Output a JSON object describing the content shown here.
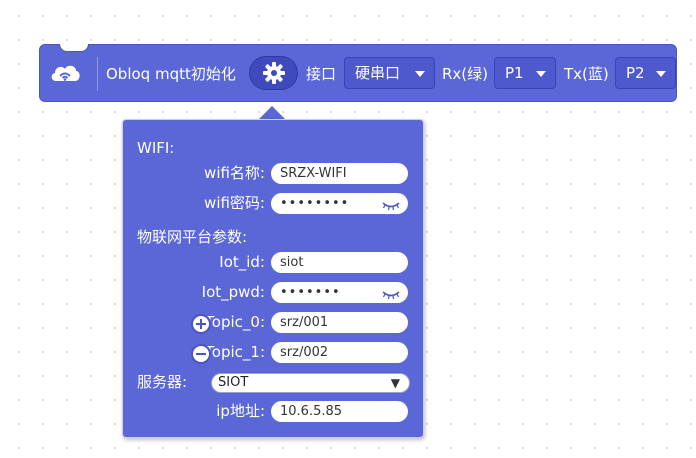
{
  "block": {
    "cloud_icon": "cloud-wifi-icon",
    "title": "Obloq mqtt初始化",
    "gear_icon": "gear-icon",
    "interface_label": "接口",
    "interface_value": "硬串口",
    "rx_label": "Rx(绿)",
    "rx_value": "P1",
    "tx_label": "Tx(蓝)",
    "tx_value": "P2"
  },
  "panel": {
    "wifi_heading": "WIFI:",
    "wifi_name_label": "wifi名称:",
    "wifi_name_value": "SRZX-WIFI",
    "wifi_pwd_label": "wifi密码:",
    "wifi_pwd_value": "••••••••",
    "iot_heading": "物联网平台参数:",
    "iot_id_label": "Iot_id:",
    "iot_id_value": "siot",
    "iot_pwd_label": "Iot_pwd:",
    "iot_pwd_value": "•••••••",
    "topic0_label": "Topic_0:",
    "topic0_value": "srz/001",
    "topic1_label": "Topic_1:",
    "topic1_value": "srz/002",
    "server_label": "服务器:",
    "server_value": "SIOT",
    "ip_label": "ip地址:",
    "ip_value": "10.6.5.85",
    "add_icon": "plus-circle-icon",
    "remove_icon": "minus-circle-icon",
    "eye_icon": "eye-closed-icon"
  },
  "colors": {
    "block_bg": "#5b67d6",
    "block_border": "#4a55c2",
    "dropdown_bg": "#4d59cd",
    "text": "#ffffff"
  }
}
